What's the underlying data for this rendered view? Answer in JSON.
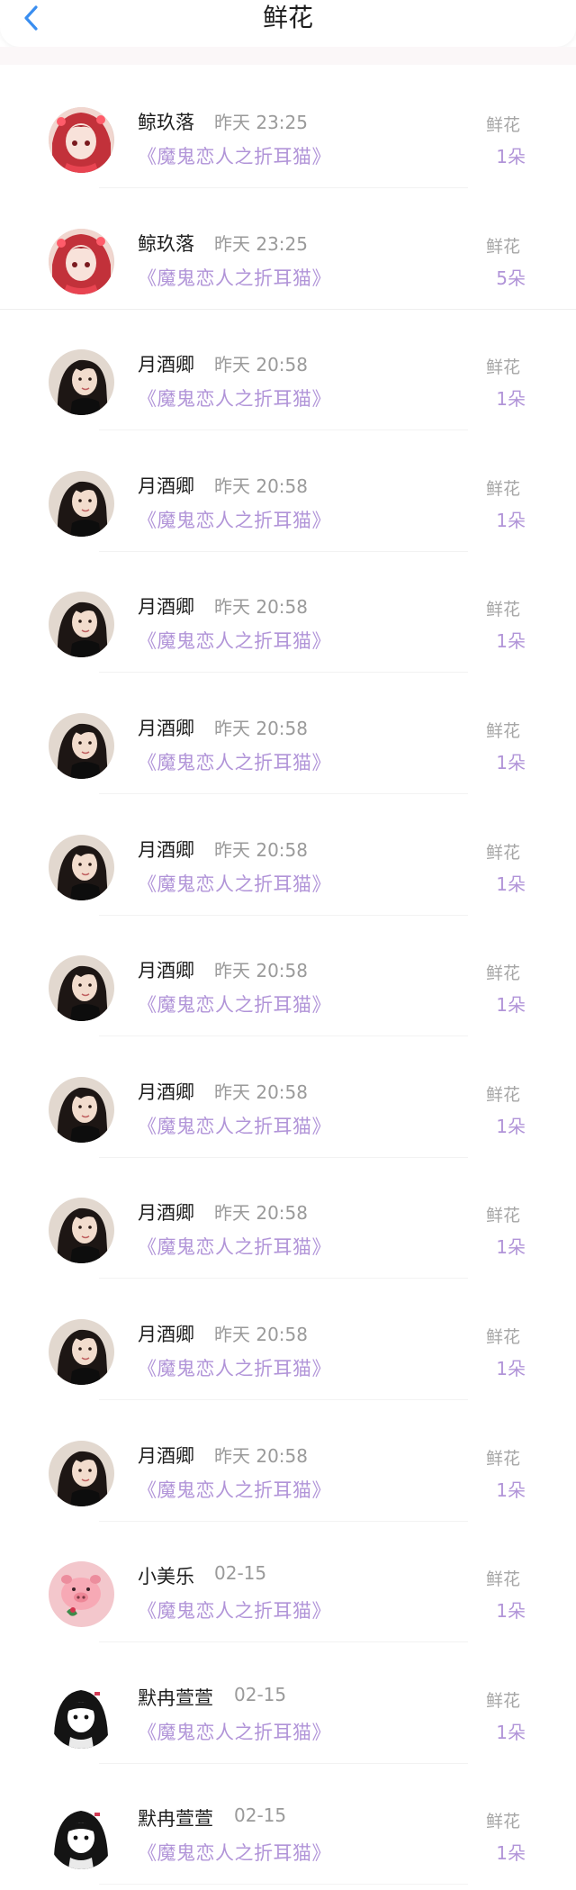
{
  "header": {
    "title": "鲜花",
    "back_icon": "chevron-left-icon",
    "accent": "#3a8ef0"
  },
  "colors": {
    "book_title": "#b194d8",
    "muted": "#9a9a9a"
  },
  "records": [
    {
      "name": "鲸玖落",
      "time": "昨天 23:25",
      "book": "《魔鬼恋人之折耳猫》",
      "gift": "鲜花",
      "count": "1朵",
      "avatar": "anime-girl-red"
    },
    {
      "name": "鲸玖落",
      "time": "昨天 23:25",
      "book": "《魔鬼恋人之折耳猫》",
      "gift": "鲜花",
      "count": "5朵",
      "avatar": "anime-girl-red"
    },
    {
      "name": "月酒卿",
      "time": "昨天 20:58",
      "book": "《魔鬼恋人之折耳猫》",
      "gift": "鲜花",
      "count": "1朵",
      "avatar": "portrait-dark-hair"
    },
    {
      "name": "月酒卿",
      "time": "昨天 20:58",
      "book": "《魔鬼恋人之折耳猫》",
      "gift": "鲜花",
      "count": "1朵",
      "avatar": "portrait-dark-hair"
    },
    {
      "name": "月酒卿",
      "time": "昨天 20:58",
      "book": "《魔鬼恋人之折耳猫》",
      "gift": "鲜花",
      "count": "1朵",
      "avatar": "portrait-dark-hair"
    },
    {
      "name": "月酒卿",
      "time": "昨天 20:58",
      "book": "《魔鬼恋人之折耳猫》",
      "gift": "鲜花",
      "count": "1朵",
      "avatar": "portrait-dark-hair"
    },
    {
      "name": "月酒卿",
      "time": "昨天 20:58",
      "book": "《魔鬼恋人之折耳猫》",
      "gift": "鲜花",
      "count": "1朵",
      "avatar": "portrait-dark-hair"
    },
    {
      "name": "月酒卿",
      "time": "昨天 20:58",
      "book": "《魔鬼恋人之折耳猫》",
      "gift": "鲜花",
      "count": "1朵",
      "avatar": "portrait-dark-hair"
    },
    {
      "name": "月酒卿",
      "time": "昨天 20:58",
      "book": "《魔鬼恋人之折耳猫》",
      "gift": "鲜花",
      "count": "1朵",
      "avatar": "portrait-dark-hair"
    },
    {
      "name": "月酒卿",
      "time": "昨天 20:58",
      "book": "《魔鬼恋人之折耳猫》",
      "gift": "鲜花",
      "count": "1朵",
      "avatar": "portrait-dark-hair"
    },
    {
      "name": "月酒卿",
      "time": "昨天 20:58",
      "book": "《魔鬼恋人之折耳猫》",
      "gift": "鲜花",
      "count": "1朵",
      "avatar": "portrait-dark-hair"
    },
    {
      "name": "月酒卿",
      "time": "昨天 20:58",
      "book": "《魔鬼恋人之折耳猫》",
      "gift": "鲜花",
      "count": "1朵",
      "avatar": "portrait-dark-hair"
    },
    {
      "name": "小美乐",
      "time": "02-15",
      "book": "《魔鬼恋人之折耳猫》",
      "gift": "鲜花",
      "count": "1朵",
      "avatar": "pink-pig"
    },
    {
      "name": "默冉萱萱",
      "time": "02-15",
      "book": "《魔鬼恋人之折耳猫》",
      "gift": "鲜花",
      "count": "1朵",
      "avatar": "cartoon-girl-bw"
    },
    {
      "name": "默冉萱萱",
      "time": "02-15",
      "book": "《魔鬼恋人之折耳猫》",
      "gift": "鲜花",
      "count": "1朵",
      "avatar": "cartoon-girl-bw"
    }
  ]
}
